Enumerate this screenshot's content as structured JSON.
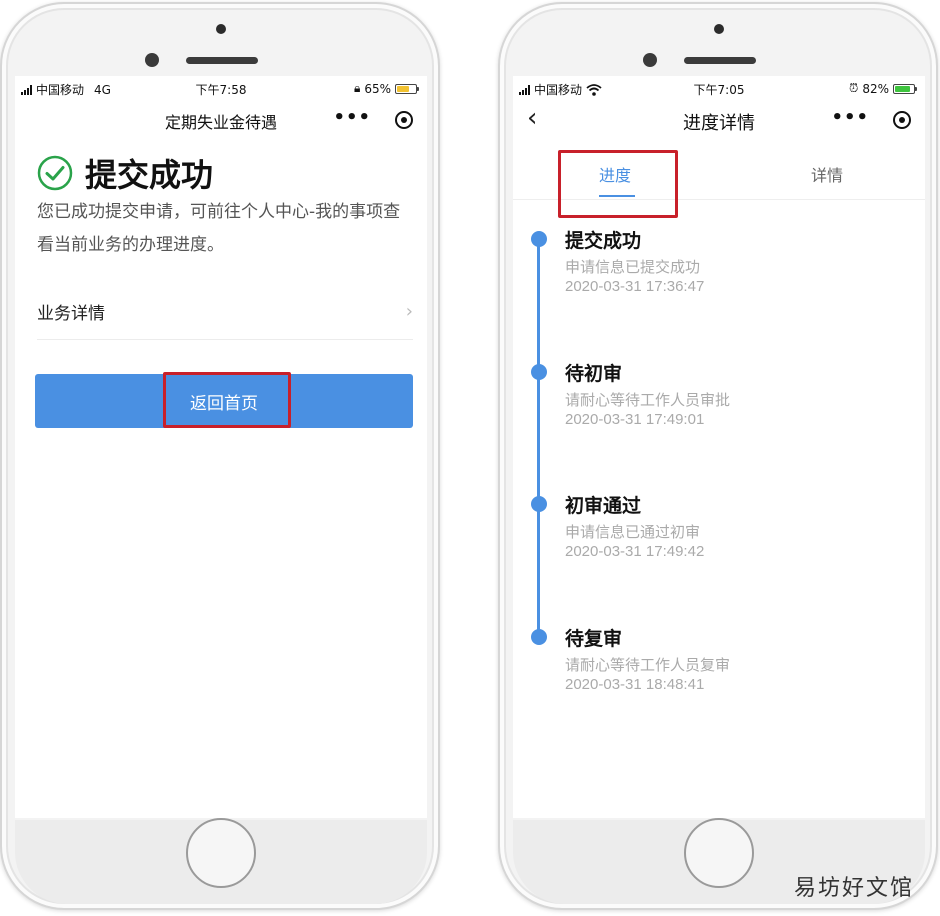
{
  "left_phone": {
    "status": {
      "carrier": "中国移动",
      "network": "4G",
      "time": "下午7:58",
      "battery_pct": "65%",
      "battery_level": 0.65,
      "battery_color": "#f2c230"
    },
    "nav": {
      "title": "定期失业金待遇"
    },
    "success": {
      "title": "提交成功",
      "description": "您已成功提交申请，可前往个人中心-我的事项查看当前业务的办理进度。"
    },
    "detail_row": {
      "label": "业务详情"
    },
    "home_button": {
      "label": "返回首页"
    }
  },
  "right_phone": {
    "status": {
      "carrier": "中国移动",
      "time": "下午7:05",
      "battery_pct": "82%",
      "battery_level": 0.82,
      "battery_color": "#3ec43e"
    },
    "nav": {
      "title": "进度详情"
    },
    "tabs": [
      {
        "label": "进度"
      },
      {
        "label": "详情"
      }
    ],
    "timeline": [
      {
        "title": "提交成功",
        "desc": "申请信息已提交成功",
        "time": "2020-03-31 17:36:47"
      },
      {
        "title": "待初审",
        "desc": "请耐心等待工作人员审批",
        "time": "2020-03-31 17:49:01"
      },
      {
        "title": "初审通过",
        "desc": "申请信息已通过初审",
        "time": "2020-03-31 17:49:42"
      },
      {
        "title": "待复审",
        "desc": "请耐心等待工作人员复审",
        "time": "2020-03-31 18:48:41"
      }
    ]
  },
  "colors": {
    "accent": "#4a90e2",
    "highlight": "#c8202a",
    "success": "#2aa34a"
  },
  "watermark": "易坊好文馆"
}
